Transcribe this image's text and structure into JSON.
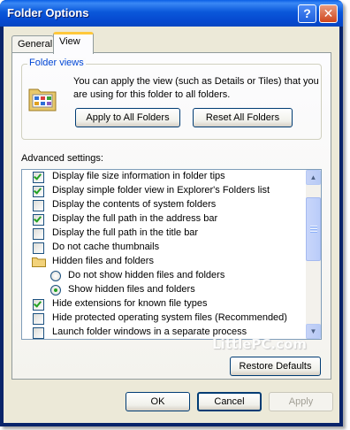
{
  "window": {
    "title": "Folder Options",
    "help_icon": "question-mark-icon",
    "close_icon": "close-x-icon"
  },
  "tabs": [
    {
      "label": "General",
      "selected": false
    },
    {
      "label": "View",
      "selected": true
    }
  ],
  "folder_views": {
    "title": "Folder views",
    "description": "You can apply the view (such as Details or Tiles) that you are using for this folder to all folders.",
    "apply_all_label": "Apply to All Folders",
    "reset_all_label": "Reset All Folders"
  },
  "advanced": {
    "label": "Advanced settings:",
    "items": [
      {
        "type": "checkbox",
        "label": "Display file size information in folder tips",
        "checked": true
      },
      {
        "type": "checkbox",
        "label": "Display simple folder view in Explorer's Folders list",
        "checked": true
      },
      {
        "type": "checkbox",
        "label": "Display the contents of system folders",
        "checked": false
      },
      {
        "type": "checkbox",
        "label": "Display the full path in the address bar",
        "checked": true
      },
      {
        "type": "checkbox",
        "label": "Display the full path in the title bar",
        "checked": false
      },
      {
        "type": "checkbox",
        "label": "Do not cache thumbnails",
        "checked": false
      },
      {
        "type": "folder",
        "label": "Hidden files and folders"
      },
      {
        "type": "radio",
        "label": "Do not show hidden files and folders",
        "checked": false
      },
      {
        "type": "radio",
        "label": "Show hidden files and folders",
        "checked": true
      },
      {
        "type": "checkbox",
        "label": "Hide extensions for known file types",
        "checked": true
      },
      {
        "type": "checkbox",
        "label": "Hide protected operating system files (Recommended)",
        "checked": false
      },
      {
        "type": "checkbox",
        "label": "Launch folder windows in a separate process",
        "checked": false
      }
    ],
    "restore_label": "Restore Defaults"
  },
  "watermark": "LittlePC.com",
  "footer": {
    "ok_label": "OK",
    "cancel_label": "Cancel",
    "apply_label": "Apply",
    "apply_enabled": false
  },
  "colors": {
    "titlebar": "#0A58DA",
    "client": "#ECE9D8",
    "group_title": "#0046D5",
    "check": "#21A121"
  }
}
